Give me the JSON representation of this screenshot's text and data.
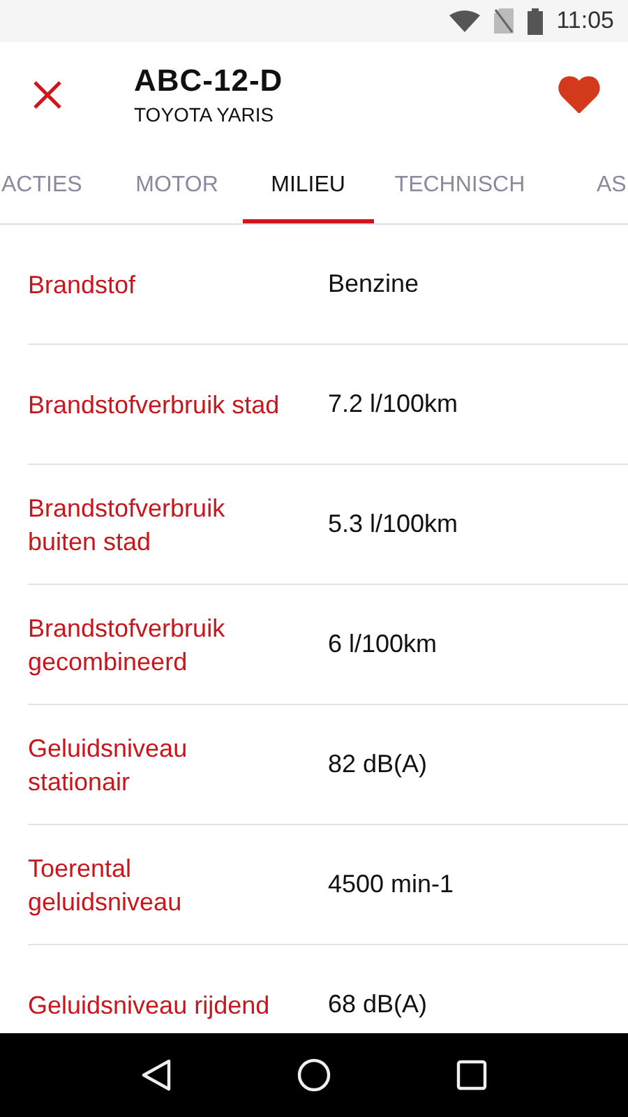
{
  "status_bar": {
    "time": "11:05"
  },
  "header": {
    "plate": "ABC-12-D",
    "model": "TOYOTA YARIS",
    "favorite": true
  },
  "tabs": [
    {
      "label": "ACTIES",
      "selected": false
    },
    {
      "label": "MOTOR",
      "selected": false
    },
    {
      "label": "MILIEU",
      "selected": true
    },
    {
      "label": "TECHNISCH",
      "selected": false
    },
    {
      "label": "AS",
      "selected": false
    }
  ],
  "rows": [
    {
      "label": "Brandstof",
      "value": "Benzine"
    },
    {
      "label": "Brandstofverbruik stad",
      "value": "7.2 l/100km"
    },
    {
      "label": "Brandstofverbruik buiten stad",
      "value": "5.3 l/100km"
    },
    {
      "label": "Brandstofverbruik gecombineerd",
      "value": "6 l/100km"
    },
    {
      "label": "Geluidsniveau stationair",
      "value": "82 dB(A)"
    },
    {
      "label": "Toerental geluidsniveau",
      "value": "4500 min-1"
    },
    {
      "label": "Geluidsniveau rijdend",
      "value": "68 dB(A)"
    }
  ]
}
